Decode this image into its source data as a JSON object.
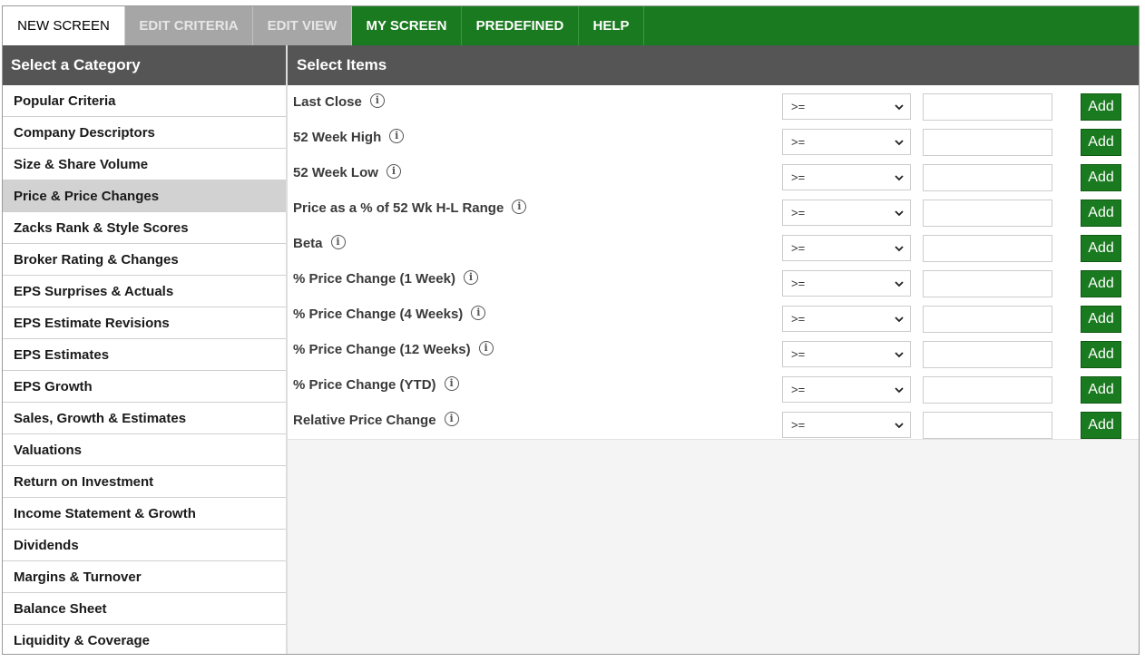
{
  "tabs": [
    {
      "label": "NEW SCREEN",
      "state": "active"
    },
    {
      "label": "EDIT CRITERIA",
      "state": "disabled"
    },
    {
      "label": "EDIT VIEW",
      "state": "disabled"
    },
    {
      "label": "MY SCREEN",
      "state": "normal"
    },
    {
      "label": "PREDEFINED",
      "state": "normal"
    },
    {
      "label": "HELP",
      "state": "normal"
    }
  ],
  "category_panel": {
    "title": "Select a Category",
    "items": [
      "Popular Criteria",
      "Company Descriptors",
      "Size & Share Volume",
      "Price & Price Changes",
      "Zacks Rank & Style Scores",
      "Broker Rating & Changes",
      "EPS Surprises & Actuals",
      "EPS Estimate Revisions",
      "EPS Estimates",
      "EPS Growth",
      "Sales, Growth & Estimates",
      "Valuations",
      "Return on Investment",
      "Income Statement & Growth",
      "Dividends",
      "Margins & Turnover",
      "Balance Sheet",
      "Liquidity & Coverage"
    ],
    "selected": "Price & Price Changes"
  },
  "items_panel": {
    "title": "Select Items",
    "rows": [
      {
        "label": "Last Close",
        "operator": ">=",
        "value": "",
        "button": "Add"
      },
      {
        "label": "52 Week High",
        "operator": ">=",
        "value": "",
        "button": "Add"
      },
      {
        "label": "52 Week Low",
        "operator": ">=",
        "value": "",
        "button": "Add"
      },
      {
        "label": "Price as a % of 52 Wk H-L Range",
        "operator": ">=",
        "value": "",
        "button": "Add"
      },
      {
        "label": "Beta",
        "operator": ">=",
        "value": "",
        "button": "Add"
      },
      {
        "label": "% Price Change (1 Week)",
        "operator": ">=",
        "value": "",
        "button": "Add"
      },
      {
        "label": "% Price Change (4 Weeks)",
        "operator": ">=",
        "value": "",
        "button": "Add"
      },
      {
        "label": "% Price Change (12 Weeks)",
        "operator": ">=",
        "value": "",
        "button": "Add"
      },
      {
        "label": "% Price Change (YTD)",
        "operator": ">=",
        "value": "",
        "button": "Add"
      },
      {
        "label": "Relative Price Change",
        "operator": ">=",
        "value": "",
        "button": "Add"
      }
    ]
  },
  "icons": {
    "info": "info-icon",
    "dropdown": "chevron-down-icon"
  },
  "colors": {
    "brand_green": "#1a7a1f",
    "header_gray": "#555555",
    "selected_gray": "#d2d2d2",
    "disabled_tab": "#a6a6a6"
  }
}
